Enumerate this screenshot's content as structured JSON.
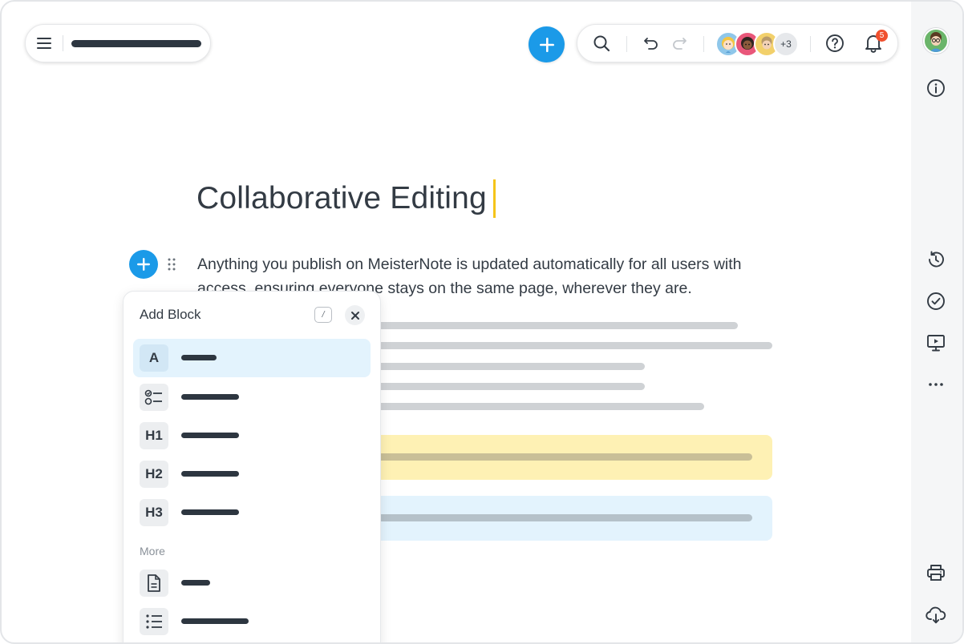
{
  "header": {
    "menu_icon": "hamburger-menu-icon",
    "add_icon": "plus-icon",
    "search_icon": "search-icon",
    "undo_icon": "undo-icon",
    "redo_icon": "redo-icon",
    "collaborators_more": "+3",
    "help_icon": "help-circle-icon",
    "bell_icon": "bell-icon",
    "notification_count": "5"
  },
  "document": {
    "title": "Collaborative Editing",
    "paragraph": "Anything you publish on MeisterNote is updated automatically for all users with access, ensuring everyone stays on the same page, wherever they are."
  },
  "add_block": {
    "title": "Add Block",
    "shortcut": "/",
    "close_icon": "close-icon",
    "items": [
      {
        "icon": "text-icon",
        "glyph": "A"
      },
      {
        "icon": "checklist-icon",
        "glyph": ""
      },
      {
        "icon": "heading-1-icon",
        "glyph": "H1"
      },
      {
        "icon": "heading-2-icon",
        "glyph": "H2"
      },
      {
        "icon": "heading-3-icon",
        "glyph": "H3"
      }
    ],
    "more_label": "More",
    "more_items": [
      {
        "icon": "page-icon"
      },
      {
        "icon": "bulleted-list-icon"
      }
    ]
  },
  "sidebar": {
    "icons": [
      "user-avatar",
      "info-icon",
      "history-icon",
      "check-circle-icon",
      "presentation-icon",
      "more-icon",
      "print-icon",
      "cloud-download-icon"
    ]
  },
  "colors": {
    "accent": "#1b9ae8",
    "caret": "#f5c419",
    "callout_yellow": "#fef1b4",
    "callout_blue": "#e3f3fd",
    "badge": "#f0502e"
  }
}
